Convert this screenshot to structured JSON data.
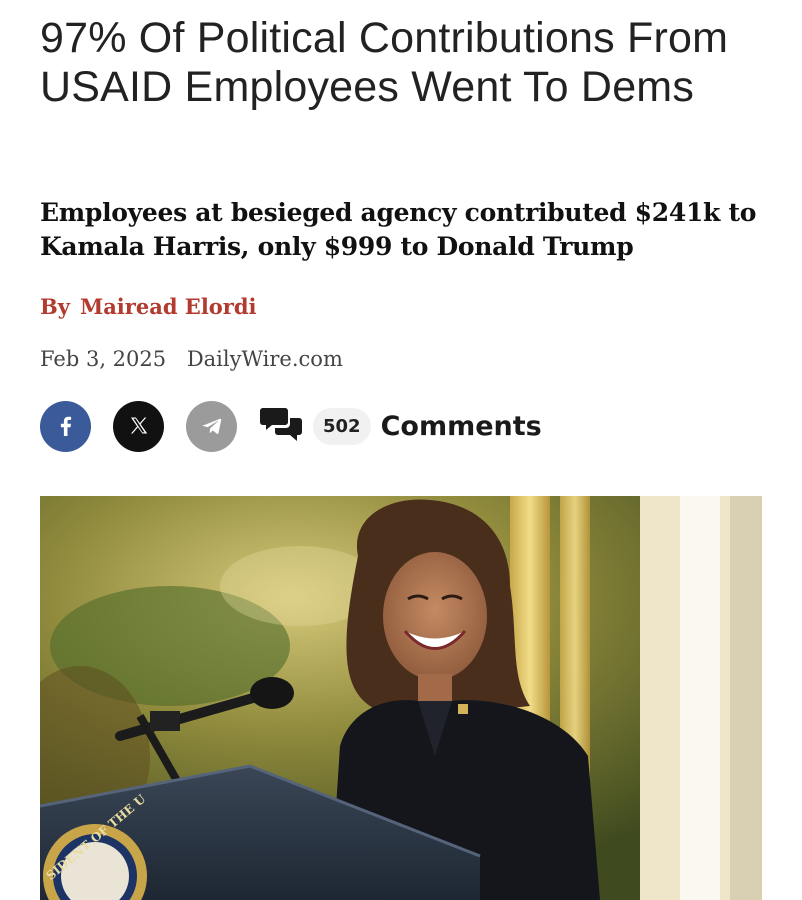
{
  "article": {
    "headline": "97% Of Political Contributions From USAID Employees Went To Dems",
    "subheadline": "Employees at besieged agency contributed $241k to Kamala Harris, only $999 to Donald Trump",
    "byline_prefix": "By",
    "author": "Mairead Elordi",
    "date": "Feb 3, 2025",
    "source": "DailyWire.com"
  },
  "share": {
    "facebook_icon": "facebook-icon",
    "x_icon": "x-icon",
    "telegram_icon": "telegram-icon",
    "comments_icon": "speech-bubbles-icon",
    "comment_count": "502",
    "comments_label": "Comments"
  },
  "colors": {
    "byline": "#b33a2e",
    "facebook": "#3b5a9a",
    "x": "#111111",
    "telegram": "#9b9b9b"
  },
  "hero_image": {
    "seal_text": "SIDENT OF THE U"
  }
}
